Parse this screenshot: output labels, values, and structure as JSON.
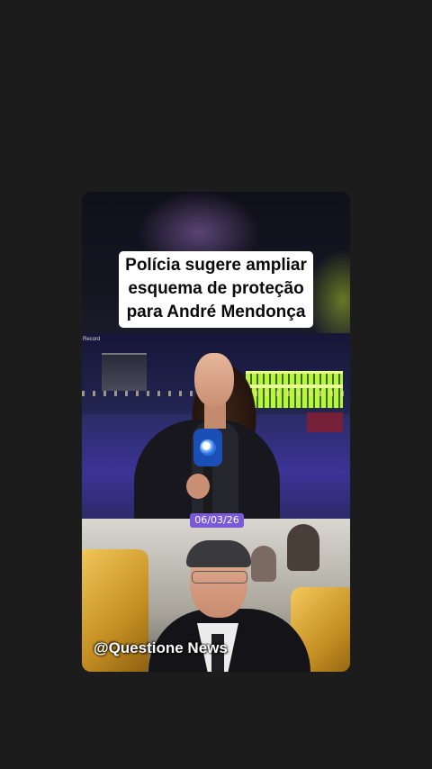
{
  "post": {
    "headline_lines": [
      "Polícia sugere ampliar",
      "esquema de proteção",
      "para André Mendonça"
    ],
    "news_logo": "Record",
    "date": "06/03/26",
    "watermark": "@Questione News"
  },
  "colors": {
    "page_background": "#1c1c1c",
    "date_badge": "#7a5ad8",
    "headline_box": "#ffffff"
  }
}
